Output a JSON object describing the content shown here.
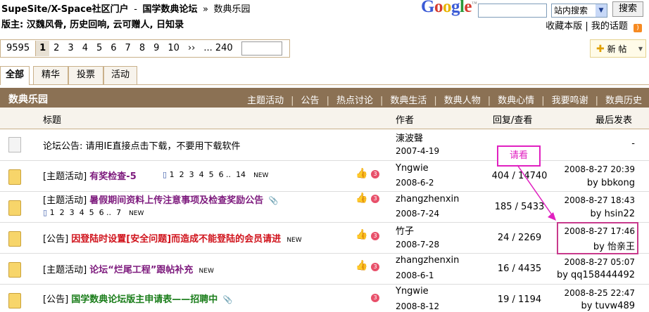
{
  "header": {
    "site_link": "SupeSite/X-Space社区门户",
    "forum_link": "国学数典论坛",
    "current": "数典乐园",
    "moderators_label": "版主:",
    "moderators": "汉魏风骨, 历史回响, 云可赠人, 日知录"
  },
  "search": {
    "logo": "Google",
    "scope": "站内搜索",
    "button": "搜索"
  },
  "top_links": {
    "archive": "收藏本版",
    "my_topics": "我的话题"
  },
  "pager": {
    "total": "9595",
    "pages": [
      "1",
      "2",
      "3",
      "4",
      "5",
      "6",
      "7",
      "8",
      "9",
      "10"
    ],
    "current": "1",
    "next": "››",
    "last": "... 240"
  },
  "new_post": "新 帖",
  "tabs": [
    "全部",
    "精华",
    "投票",
    "活动"
  ],
  "forum": {
    "name": "数典乐园",
    "categories": [
      "主题活动",
      "公告",
      "热点讨论",
      "数典生活",
      "数典人物",
      "数典心情",
      "我要鸣谢",
      "数典历史"
    ]
  },
  "table_headers": {
    "subject": "标题",
    "author": "作者",
    "counts": "回复/查看",
    "last": "最后发表"
  },
  "threads": [
    {
      "tag": "",
      "title": "论坛公告: 请用IE直接点击下载，不要用下载软件",
      "author": "涷波聲",
      "date": "2007-4-19",
      "counts": "-",
      "last_time": "",
      "last_by": "-"
    },
    {
      "tag": "[主题活动]",
      "title": "有奖检查-5",
      "new": "",
      "pages": [
        "1",
        "2",
        "3",
        "4",
        "5",
        "6 ..",
        "14"
      ],
      "pages_new": "NEW",
      "author": "Yngwie",
      "date": "2008-6-2",
      "counts": "404 / 14740",
      "last_time": "2008-8-27 20:39",
      "last_by": "by bbkong"
    },
    {
      "tag": "[主题活动]",
      "title": "暑假期间资料上传注意事项及检查奖励公告",
      "pages": [
        "1",
        "2",
        "3",
        "4",
        "5",
        "6 ..",
        "7"
      ],
      "pages_new": "NEW",
      "author": "zhangzhenxin",
      "date": "2008-7-24",
      "counts": "185 / 5433",
      "last_time": "2008-8-27 18:43",
      "last_by": "by hsin22"
    },
    {
      "tag": "[公告]",
      "title": "因登陆时设置[安全问题]而造成不能登陆的会员请进",
      "new": "NEW",
      "author": "竹子",
      "date": "2008-7-28",
      "counts": "24 / 2269",
      "last_time": "2008-8-27 17:46",
      "last_by": "by 怡亲王"
    },
    {
      "tag": "[主题活动]",
      "title": "论坛“烂尾工程”跟帖补充",
      "new": "NEW",
      "author": "zhangzhenxin",
      "date": "2008-6-1",
      "counts": "16 / 4435",
      "last_time": "2008-8-27 05:07",
      "last_by": "by qq158444492"
    },
    {
      "tag": "[公告]",
      "title": "国学数典论坛版主申请表——招聘中",
      "author": "Yngwie",
      "date": "2008-8-12",
      "counts": "19 / 1194",
      "last_time": "2008-8-25 22:47",
      "last_by": "by tuvw489"
    }
  ],
  "annotation": "请看",
  "colors": {
    "forum_bar": "#8b7154",
    "annotation": "#e020c0"
  }
}
